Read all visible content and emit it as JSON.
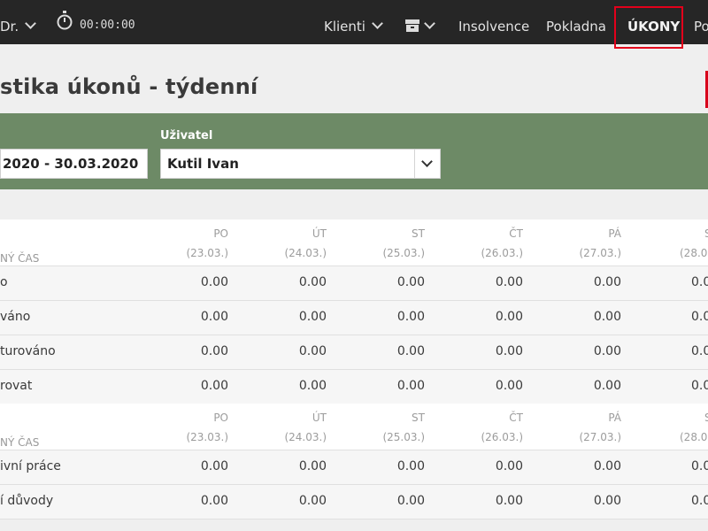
{
  "header": {
    "user_fragment": "Dr.",
    "timer": "00:00:00",
    "nav": [
      {
        "label": "Klienti"
      },
      {
        "label": "Insolvence"
      },
      {
        "label": "Pokladna"
      },
      {
        "label": "ÚKONY",
        "active": true
      },
      {
        "label": "Po"
      }
    ],
    "active_highlight_color": "#e3001b"
  },
  "page": {
    "title": "stika úkonů - týdenní"
  },
  "filter": {
    "date_value": "2020 - 30.03.2020",
    "user_label": "Uživatel",
    "user_value": "Kutil Ivan"
  },
  "tables": [
    {
      "header_label": "NÝ ČAS",
      "days": [
        {
          "day": "PO",
          "date": "(23.03.)"
        },
        {
          "day": "ÚT",
          "date": "(24.03.)"
        },
        {
          "day": "ST",
          "date": "(25.03.)"
        },
        {
          "day": "ČT",
          "date": "(26.03.)"
        },
        {
          "day": "PÁ",
          "date": "(27.03.)"
        },
        {
          "day": "S",
          "date": "(28.03."
        }
      ],
      "rows": [
        {
          "label": "o",
          "values": [
            "0.00",
            "0.00",
            "0.00",
            "0.00",
            "0.00",
            "0.0"
          ]
        },
        {
          "label": "váno",
          "values": [
            "0.00",
            "0.00",
            "0.00",
            "0.00",
            "0.00",
            "0.0"
          ]
        },
        {
          "label": "turováno",
          "values": [
            "0.00",
            "0.00",
            "0.00",
            "0.00",
            "0.00",
            "0.0"
          ]
        },
        {
          "label": "rovat",
          "values": [
            "0.00",
            "0.00",
            "0.00",
            "0.00",
            "0.00",
            "0.0"
          ]
        }
      ]
    },
    {
      "header_label": "NÝ ČAS",
      "days": [
        {
          "day": "PO",
          "date": "(23.03.)"
        },
        {
          "day": "ÚT",
          "date": "(24.03.)"
        },
        {
          "day": "ST",
          "date": "(25.03.)"
        },
        {
          "day": "ČT",
          "date": "(26.03.)"
        },
        {
          "day": "PÁ",
          "date": "(27.03.)"
        },
        {
          "day": "S",
          "date": "(28.03."
        }
      ],
      "rows": [
        {
          "label": "ivní práce",
          "values": [
            "0.00",
            "0.00",
            "0.00",
            "0.00",
            "0.00",
            "0.0"
          ]
        },
        {
          "label": "í důvody",
          "values": [
            "0.00",
            "0.00",
            "0.00",
            "0.00",
            "0.00",
            "0.0"
          ]
        }
      ]
    }
  ]
}
